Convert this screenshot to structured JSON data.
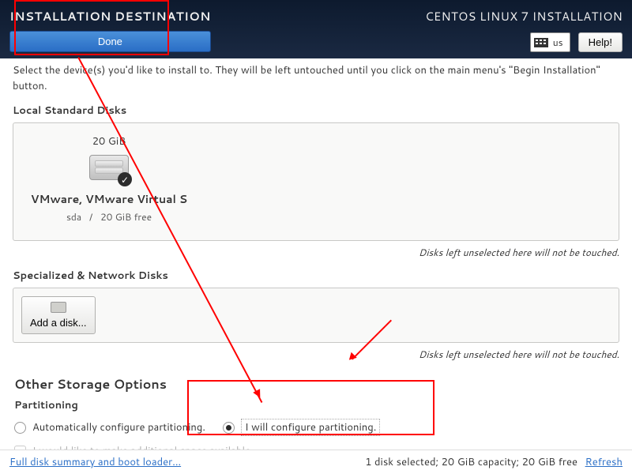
{
  "header": {
    "title": "INSTALLATION DESTINATION",
    "done_label": "Done",
    "install_title": "CENTOS LINUX 7 INSTALLATION",
    "keyboard": "us",
    "help_label": "Help!"
  },
  "instructions": "Select the device(s) you'd like to install to.  They will be left untouched until you click on the main menu's \"Begin Installation\" button.",
  "local_disks": {
    "label": "Local Standard Disks",
    "note": "Disks left unselected here will not be touched.",
    "items": [
      {
        "size": "20 GiB",
        "name": "VMware, VMware Virtual S",
        "device": "sda",
        "free": "20 GiB free",
        "selected": true
      }
    ]
  },
  "network_disks": {
    "label": "Specialized & Network Disks",
    "add_label": "Add a disk...",
    "note": "Disks left unselected here will not be touched."
  },
  "other_storage": {
    "heading": "Other Storage Options",
    "partitioning_label": "Partitioning",
    "auto_label": "Automatically configure partitioning.",
    "manual_label": "I will configure partitioning.",
    "extra_space_label": "I would like to make additional space available."
  },
  "footer": {
    "summary_link": "Full disk summary and boot loader...",
    "status": "1 disk selected; 20 GiB capacity; 20 GiB free",
    "refresh": "Refresh"
  }
}
